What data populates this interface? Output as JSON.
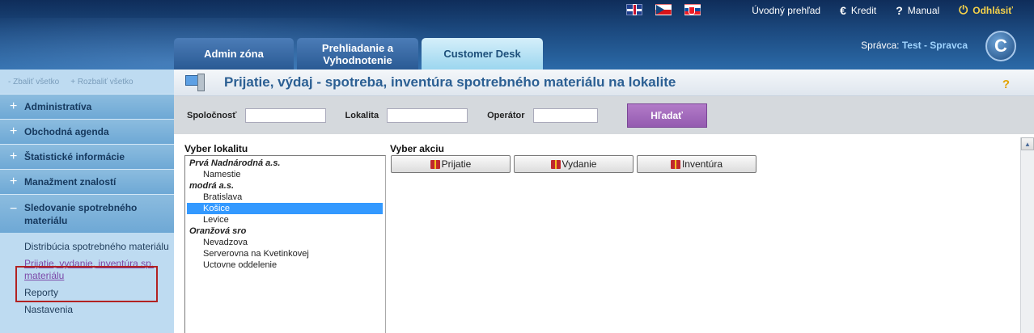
{
  "header": {
    "flags": [
      "flag-uk-icon",
      "flag-cz-icon",
      "flag-sk-icon"
    ],
    "topnav": {
      "overview": "Úvodný prehľad",
      "credit": "Kredit",
      "manual": "Manual",
      "logout": "Odhlásiť"
    },
    "tabs": [
      {
        "label": "Admin zóna"
      },
      {
        "label": "Prehliadanie a Vyhodnotenie"
      },
      {
        "label": "Customer Desk"
      }
    ],
    "admin_label": "Správca:",
    "admin_name": "Test - Spravca",
    "logo_letter": "C"
  },
  "sidebar": {
    "collapse_all": "- Zbaliť všetko",
    "expand_all": "+ Rozbaliť všetko",
    "items": [
      {
        "label": "Administratíva"
      },
      {
        "label": "Obchodná agenda"
      },
      {
        "label": "Štatistické informácie"
      },
      {
        "label": "Manažment znalostí"
      },
      {
        "label": "Sledovanie spotrebného materiálu"
      }
    ],
    "submenu": [
      {
        "label": "Distribúcia spotrebného materiálu"
      },
      {
        "label": "Prijatie, vydanie, inventúra sp. materiálu"
      },
      {
        "label": "Reporty"
      },
      {
        "label": "Nastavenia"
      }
    ]
  },
  "main": {
    "title": "Prijatie, výdaj - spotreba, inventúra spotrebného materiálu na lokalite",
    "help": "?",
    "filter": {
      "company_label": "Spoločnosť",
      "location_label": "Lokalita",
      "operator_label": "Operátor",
      "search_button": "Hľadať"
    },
    "location_header": "Vyber lokalitu",
    "action_header": "Vyber akciu",
    "locations": [
      {
        "group": "Prvá Nadnárodná a.s.",
        "items": [
          "Namestie"
        ]
      },
      {
        "group": "modrá a.s.",
        "items": [
          "Bratislava",
          "Košice",
          "Levice"
        ]
      },
      {
        "group": "Oranžová sro",
        "items": [
          "Nevadzova",
          "Serverovna na Kvetinkovej",
          "Uctovne oddelenie"
        ]
      }
    ],
    "selected_location": "Košice",
    "actions": [
      {
        "label": "Prijatie"
      },
      {
        "label": "Vydanie"
      },
      {
        "label": "Inventúra"
      }
    ]
  }
}
